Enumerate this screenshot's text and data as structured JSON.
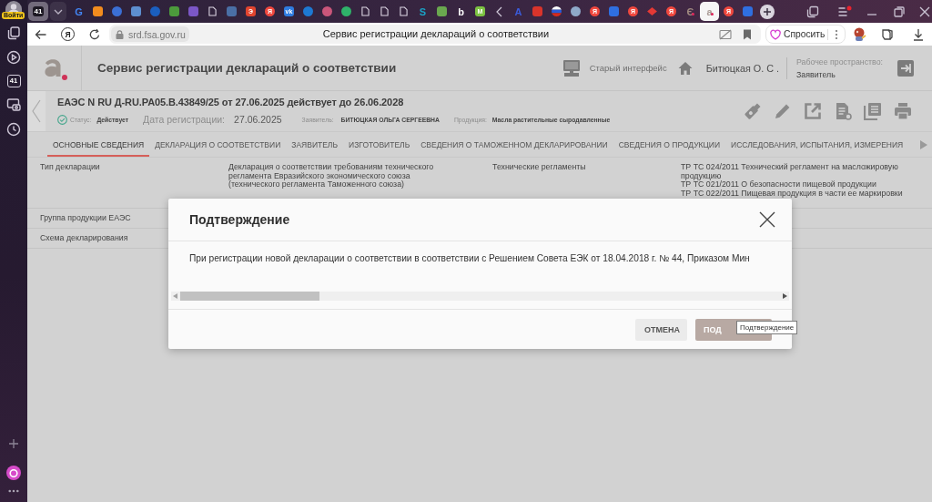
{
  "sidebar": {
    "login": "Войти",
    "tab_count": "41"
  },
  "tab_strip": {
    "tab_count": "41",
    "tabs": [
      {
        "kind": "letter",
        "glyph": "G",
        "color": "#4285f4",
        "selected": false
      },
      {
        "kind": "badge",
        "color": "#f28c1e",
        "selected": false
      },
      {
        "kind": "circle",
        "color": "#3b6fd4",
        "selected": false
      },
      {
        "kind": "badge",
        "color": "#5d8fd0",
        "selected": false
      },
      {
        "kind": "circle",
        "color": "#1b5fbf",
        "selected": false
      },
      {
        "kind": "badge",
        "color": "#4c9a3c",
        "selected": false
      },
      {
        "kind": "badge",
        "color": "#7b57c6",
        "selected": false
      },
      {
        "kind": "page",
        "selected": false
      },
      {
        "kind": "badge",
        "color": "#4a6fa5",
        "selected": false
      },
      {
        "kind": "badge",
        "glyph": "Э",
        "color": "#e2452f",
        "selected": false
      },
      {
        "kind": "circle",
        "glyph": "Я",
        "color": "#f0483e",
        "selected": false
      },
      {
        "kind": "badge",
        "glyph": "vk",
        "color": "#2f7de1",
        "selected": false
      },
      {
        "kind": "circle",
        "color": "#1d79d2",
        "selected": false
      },
      {
        "kind": "circle",
        "color": "#c9567a",
        "selected": false
      },
      {
        "kind": "circle",
        "color": "#2fb36a",
        "selected": false
      },
      {
        "kind": "page",
        "selected": false
      },
      {
        "kind": "page",
        "selected": false
      },
      {
        "kind": "page",
        "selected": false
      },
      {
        "kind": "letter",
        "glyph": "S",
        "color": "#1aa3c7",
        "selected": false
      },
      {
        "kind": "badge",
        "color": "#6aa84f",
        "selected": false
      },
      {
        "kind": "letter",
        "glyph": "b",
        "color": "#ffffff",
        "selected": false
      },
      {
        "kind": "badge",
        "glyph": "M",
        "color": "#7cc242",
        "selected": false
      },
      {
        "kind": "chevron",
        "selected": false
      },
      {
        "kind": "letter",
        "glyph": "A",
        "color": "#3b5bdb",
        "selected": false
      },
      {
        "kind": "badge",
        "color": "#d9342b",
        "selected": false
      },
      {
        "kind": "flag",
        "selected": false
      },
      {
        "kind": "circle",
        "color": "#8fa9c9",
        "selected": false
      },
      {
        "kind": "circle",
        "glyph": "Я",
        "color": "#f0483e",
        "selected": false
      },
      {
        "kind": "badge",
        "color": "#2f6fe0",
        "selected": false
      },
      {
        "kind": "circle",
        "glyph": "Я",
        "color": "#f0483e",
        "selected": false
      },
      {
        "kind": "diamond",
        "color": "#e53935",
        "selected": false
      },
      {
        "kind": "circle",
        "glyph": "Я",
        "color": "#f0483e",
        "selected": false
      },
      {
        "kind": "logo",
        "glyph": "Є",
        "color": "#a08a80",
        "selected": false
      },
      {
        "kind": "logo",
        "glyph": "a",
        "color": "#a89a94",
        "selected": true
      },
      {
        "kind": "circle",
        "glyph": "Я",
        "color": "#f0483e",
        "selected": false
      },
      {
        "kind": "badge",
        "color": "#2f6fe0",
        "selected": false
      }
    ]
  },
  "address_bar": {
    "logo_letter": "Я",
    "url": "srd.fsa.gov.ru",
    "page_title": "Сервис регистрации деклараций о соответствии",
    "ask_button": "Спросить"
  },
  "header": {
    "title": "Сервис регистрации деклараций о соответствии",
    "old_interface": "Старый интерфейс",
    "user": "Битюцкая О. С .",
    "workspace_label": "Рабочее пространство:",
    "workspace": "Заявитель"
  },
  "document": {
    "title": "ЕАЭС N RU Д-RU.PA05.B.43849/25 от 27.06.2025 действует до 26.06.2028",
    "status_label": "Статус:",
    "status": "Действует",
    "reg_date_label": "Дата регистрации:",
    "reg_date": "27.06.2025",
    "applicant_label": "Заявитель:",
    "applicant": "БИТЮЦКАЯ ОЛЬГА СЕРГЕЕВНА",
    "product_label": "Продукция:",
    "product": "Масла растительные сыродавленные"
  },
  "section_tabs": [
    {
      "label": "ОСНОВНЫЕ СВЕДЕНИЯ",
      "selected": true
    },
    {
      "label": "ДЕКЛАРАЦИЯ О СООТВЕТСТВИИ",
      "selected": false
    },
    {
      "label": "ЗАЯВИТЕЛЬ",
      "selected": false
    },
    {
      "label": "ИЗГОТОВИТЕЛЬ",
      "selected": false
    },
    {
      "label": "СВЕДЕНИЯ О ТАМОЖЕННОМ ДЕКЛАРИРОВАНИИ",
      "selected": false
    },
    {
      "label": "СВЕДЕНИЯ О ПРОДУКЦИИ",
      "selected": false
    },
    {
      "label": "ИССЛЕДОВАНИЯ, ИСПЫТАНИЯ, ИЗМЕРЕНИЯ",
      "selected": false
    }
  ],
  "details": [
    {
      "label": "Тип декларации",
      "value": "Декларация о соответствии требованиям технического регламента Евразийского экономического союза (технического регламента Таможенного союза)",
      "label_2": "Технические регламенты",
      "values_2": [
        "ТР ТС 024/2011 Технический регламент на масложировую продукцию",
        "ТР ТС 021/2011 О безопасности пищевой продукции",
        "ТР ТС 022/2011 Пищевая продукция в части ее маркировки"
      ]
    },
    {
      "label": "Группа продукции ЕАЭС"
    },
    {
      "label": "Схема декларирования"
    }
  ],
  "dialog": {
    "title": "Подтверждение",
    "message": "При регистрации новой декларации о соответствии в соответствии с Решением Совета ЕЭК от 18.04.2018 г. № 44, Приказом Мин",
    "buttons": [
      {
        "label": "ОТМЕНА",
        "kind": "secondary"
      },
      {
        "label": "ПОД",
        "kind": "primary"
      }
    ],
    "tooltip": "Подтверждение"
  }
}
